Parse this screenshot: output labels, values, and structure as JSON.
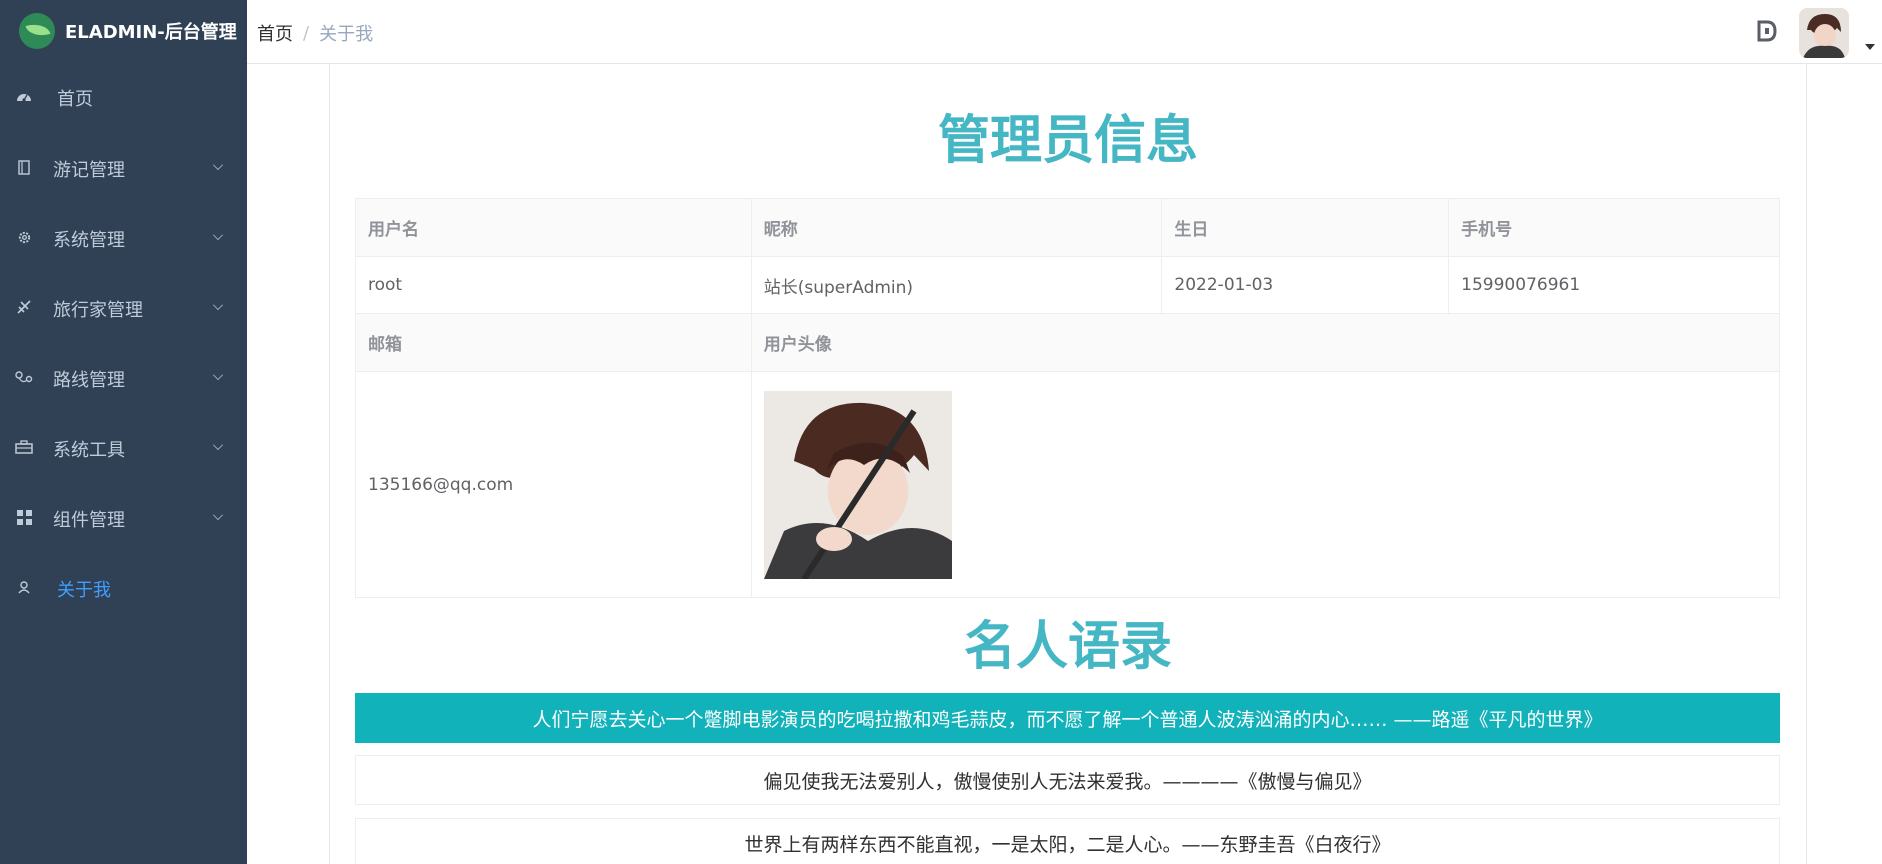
{
  "app": {
    "title": "ELADMIN-后台管理"
  },
  "sidebar": {
    "items": [
      {
        "label": "首页",
        "icon": "dashboard-icon",
        "has_children": false,
        "active": false
      },
      {
        "label": "游记管理",
        "icon": "book-icon",
        "has_children": true,
        "active": false
      },
      {
        "label": "系统管理",
        "icon": "gear-icon",
        "has_children": true,
        "active": false
      },
      {
        "label": "旅行家管理",
        "icon": "plane-icon",
        "has_children": true,
        "active": false
      },
      {
        "label": "路线管理",
        "icon": "route-icon",
        "has_children": true,
        "active": false
      },
      {
        "label": "系统工具",
        "icon": "toolbox-icon",
        "has_children": true,
        "active": false
      },
      {
        "label": "组件管理",
        "icon": "grid-icon",
        "has_children": true,
        "active": false
      },
      {
        "label": "关于我",
        "icon": "user-icon",
        "has_children": false,
        "active": true
      }
    ]
  },
  "navbar": {
    "breadcrumb": {
      "home": "首页",
      "separator": "/",
      "current": "关于我"
    }
  },
  "main": {
    "admin_title": "管理员信息",
    "table": {
      "head1": [
        "用户名",
        "昵称",
        "生日",
        "手机号"
      ],
      "row1": [
        "root",
        "站长(superAdmin)",
        "2022-01-03",
        "15990076961"
      ],
      "head2": [
        "邮箱",
        "用户头像"
      ],
      "row2_email": "135166@qq.com"
    },
    "quotes_title": "名人语录",
    "quotes": [
      "人们宁愿去关心一个蹩脚电影演员的吃喝拉撒和鸡毛蒜皮，而不愿了解一个普通人波涛汹涌的内心…… ——路遥《平凡的世界》",
      "偏见使我无法爱别人，傲慢使别人无法来爱我。————《傲慢与偏见》",
      "世界上有两样东西不能直视，一是太阳，二是人心。——东野圭吾《白夜行》"
    ]
  },
  "colors": {
    "sidebar_bg": "#304156",
    "sidebar_text": "#bfcbd9",
    "active_text": "#409eff",
    "title_teal": "#45b6c4",
    "highlight_quote_bg": "#11b2b9"
  }
}
